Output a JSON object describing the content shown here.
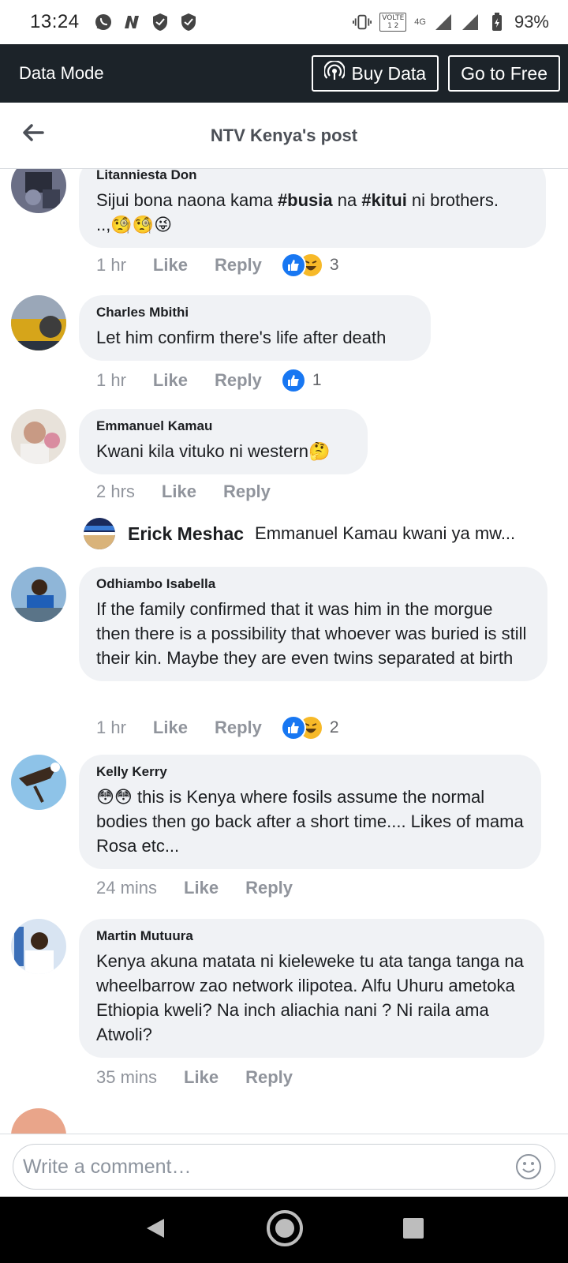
{
  "status_bar": {
    "time": "13:24",
    "volte": "VOLTE",
    "volte_sub": "1 2",
    "network": "4G",
    "battery": "93%"
  },
  "data_bar": {
    "label": "Data Mode",
    "buy_data": "Buy Data",
    "go_free": "Go to Free"
  },
  "header": {
    "title": "NTV Kenya's post"
  },
  "comments": [
    {
      "author": "Litanniesta Don",
      "text_pre": "Sijui bona naona kama ",
      "tag1": "#busia",
      "text_mid": "  na ",
      "tag2": "#kitui",
      "text_post": "  ni brothers.",
      "text_line2": "..,🧐🧐😜",
      "time": "1 hr",
      "like": "Like",
      "reply": "Reply",
      "reaction_count": "3"
    },
    {
      "author": "Charles Mbithi",
      "text": "Let him confirm there's life after death",
      "time": "1 hr",
      "like": "Like",
      "reply": "Reply",
      "reaction_count": "1"
    },
    {
      "author": "Emmanuel Kamau",
      "text": "Kwani kila vituko ni western🤔",
      "time": "2 hrs",
      "like": "Like",
      "reply": "Reply"
    },
    {
      "author": "Odhiambo Isabella",
      "text": "If the family confirmed that it was him in the morgue then there is a possibility that whoever was buried is still their kin. Maybe they are even twins separated at birth",
      "time": "1 hr",
      "like": "Like",
      "reply": "Reply",
      "reaction_count": "2"
    },
    {
      "author": "Kelly Kerry",
      "text": "😳😳 this is Kenya where fosils assume the normal bodies then go back after a short time.... Likes of mama Rosa etc...",
      "time": "24 mins",
      "like": "Like",
      "reply": "Reply"
    },
    {
      "author": "Martin Mutuura",
      "text": "Kenya akuna matata ni kieleweke tu ata tanga tanga na wheelbarrow zao network ilipotea. Alfu Uhuru ametoka Ethiopia kweli? Na inch aliachia nani  ? Ni raila ama Atwoli?",
      "time": "35 mins",
      "like": "Like",
      "reply": "Reply"
    }
  ],
  "reply_preview": {
    "name": "Erick Meshac",
    "text": "Emmanuel Kamau kwani ya mw..."
  },
  "composer": {
    "placeholder": "Write a comment…"
  },
  "colors": {
    "data_bar_bg": "#1c2329",
    "bubble_bg": "#f0f2f5",
    "like_blue": "#1877f2",
    "haha_yellow": "#f7b928"
  }
}
